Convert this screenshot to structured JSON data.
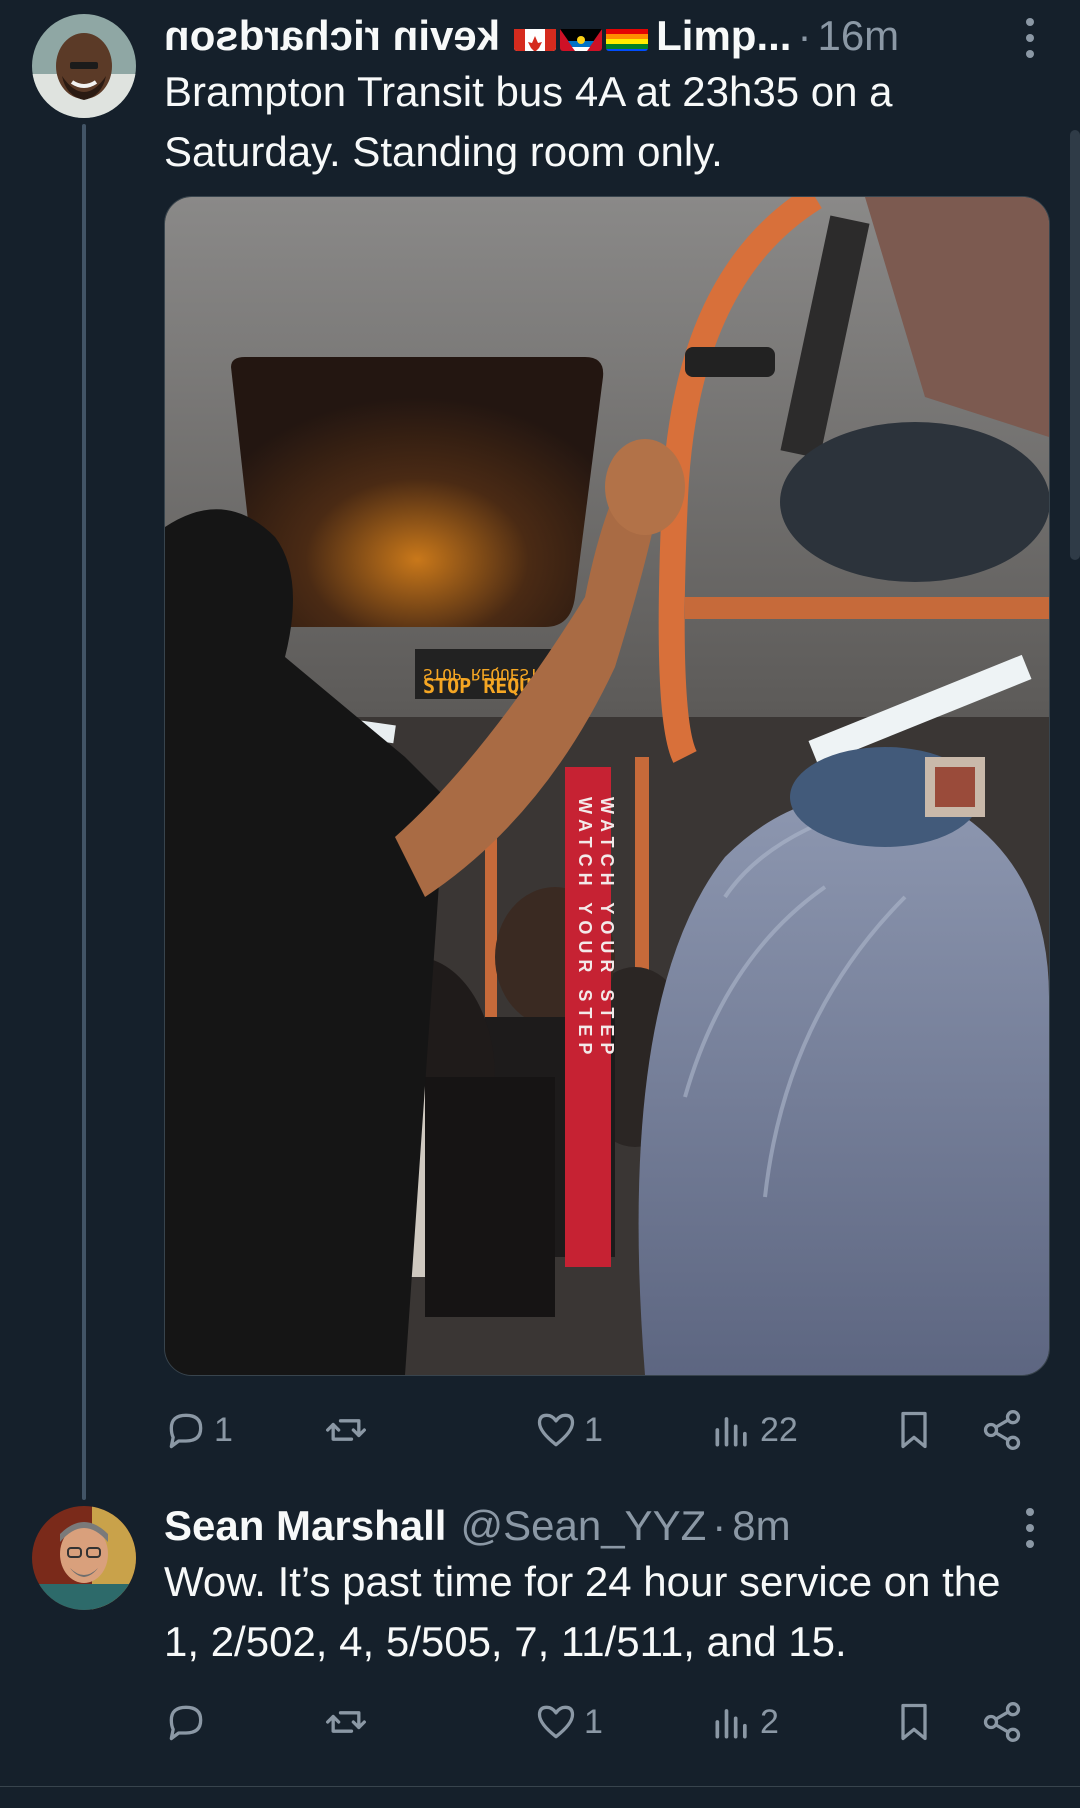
{
  "tweets": [
    {
      "author_name": "kevin richardson",
      "display_suffix": "Limp...",
      "time": "16m",
      "flag_icons": [
        "canada-flag-icon",
        "antigua-flag-icon",
        "rainbow-flag-icon"
      ],
      "text": "Brampton Transit bus 4A at 23h35 on a Saturday. Standing room only.",
      "photo": {
        "sign_top": "STOP REQUEST",
        "sign_bottom": "STOP REQU",
        "pole_text_1": "WATCH YOUR STEP",
        "pole_text_2": "WATCH YOUR STEP"
      },
      "stats": {
        "replies": "1",
        "retweets": "",
        "likes": "1",
        "views": "22"
      }
    },
    {
      "author_name": "Sean Marshall",
      "handle": "@Sean_YYZ",
      "time": "8m",
      "text": "Wow. It’s past time for 24 hour service on the 1, 2/502, 4, 5/505, 7, 11/511, and 15.",
      "stats": {
        "replies": "",
        "retweets": "",
        "likes": "1",
        "views": "2"
      }
    }
  ],
  "separator": "·",
  "colors": {
    "background": "#15202b",
    "text": "#f7f9f9",
    "muted": "#8b98a5",
    "thread_line": "#425466"
  }
}
